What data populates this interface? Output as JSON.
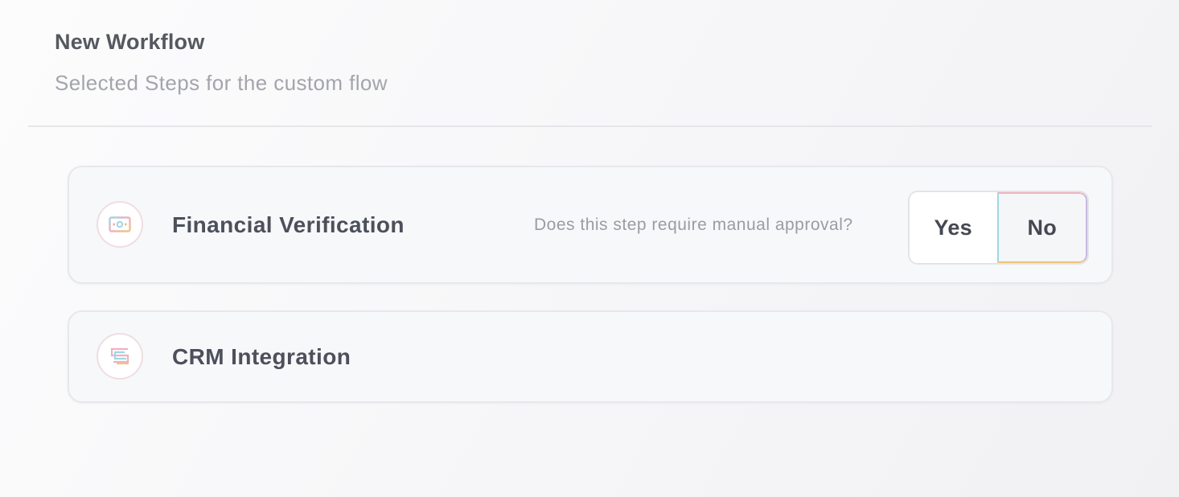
{
  "header": {
    "title": "New Workflow",
    "subtitle": "Selected Steps for the custom flow"
  },
  "steps": [
    {
      "name": "Financial Verification",
      "icon": "money-icon",
      "question": "Does this step require manual approval?",
      "options": [
        "Yes",
        "No"
      ],
      "selected": "No"
    },
    {
      "name": "CRM Integration",
      "icon": "crm-icon"
    }
  ],
  "colors": {
    "accent_pink": "#efb4c0",
    "accent_cyan": "#9ed8e0",
    "accent_yellow": "#f0c57a",
    "accent_purple": "#c8b8e0"
  }
}
